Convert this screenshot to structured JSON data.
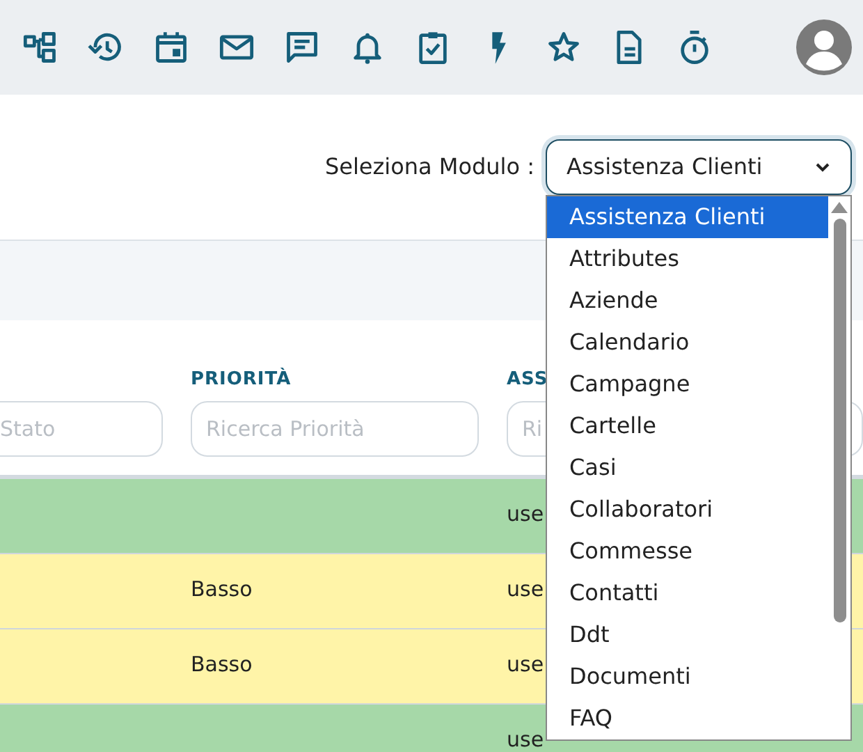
{
  "module_picker": {
    "label": "Seleziona Modulo :",
    "value": "Assistenza Clienti",
    "expanded": true,
    "options": [
      {
        "label": "Assistenza Clienti",
        "selected": true
      },
      {
        "label": "Attributes",
        "selected": false
      },
      {
        "label": "Aziende",
        "selected": false
      },
      {
        "label": "Calendario",
        "selected": false
      },
      {
        "label": "Campagne",
        "selected": false
      },
      {
        "label": "Cartelle",
        "selected": false
      },
      {
        "label": "Casi",
        "selected": false
      },
      {
        "label": "Collaboratori",
        "selected": false
      },
      {
        "label": "Commesse",
        "selected": false
      },
      {
        "label": "Contatti",
        "selected": false
      },
      {
        "label": "Ddt",
        "selected": false
      },
      {
        "label": "Documenti",
        "selected": false
      },
      {
        "label": "FAQ",
        "selected": false
      }
    ]
  },
  "table": {
    "columns": [
      {
        "placeholder": "Stato"
      },
      {
        "header": "PRIORITÀ",
        "placeholder": "Ricerca Priorità"
      },
      {
        "header": "ASS",
        "placeholder": "Ri"
      }
    ],
    "rows": [
      {
        "color": "#a6d8a8",
        "column_3": "use"
      },
      {
        "color": "#fff4a8",
        "priority": "Basso",
        "column_3": "use"
      },
      {
        "color": "#fff4a8",
        "priority": "Basso",
        "column_3": "use"
      },
      {
        "color": "#a6d8a8",
        "column_3": "use"
      }
    ]
  }
}
